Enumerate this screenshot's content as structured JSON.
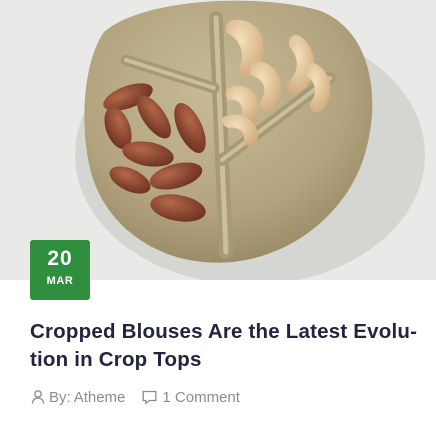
{
  "post": {
    "date": {
      "day": "20",
      "month": "MAR"
    },
    "title": "Cropped Blouses Are the Latest Evolu-tion in Crop Tops",
    "meta": {
      "author_prefix": "By:",
      "author": "Atheme",
      "comments": "1 Comment"
    }
  },
  "colors": {
    "badge": "#2f8f3f",
    "title": "#23253f",
    "meta": "#8a8b96",
    "image_background": "#e9e9e7"
  },
  "icons": {
    "author": "user-icon",
    "comments": "comment-icon"
  }
}
